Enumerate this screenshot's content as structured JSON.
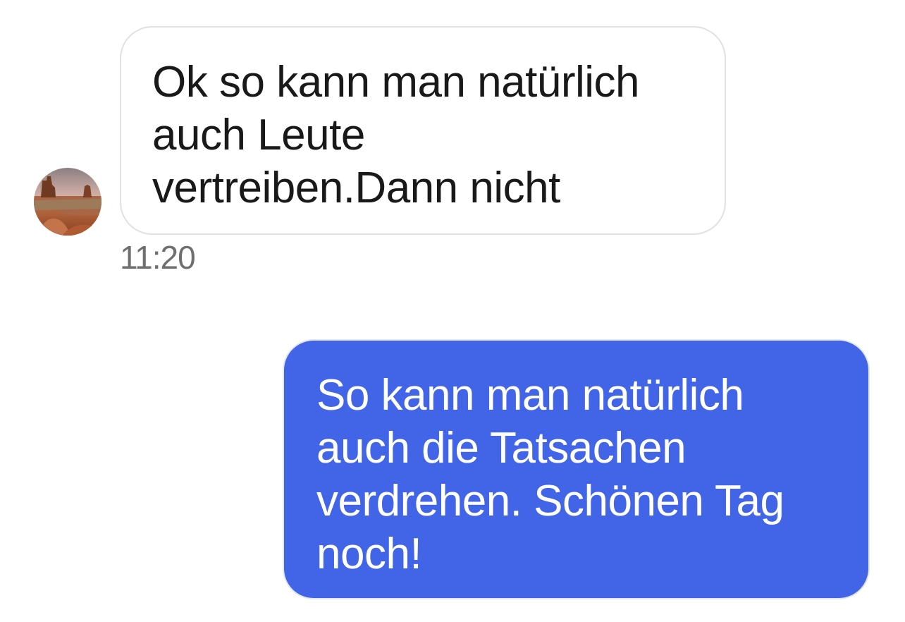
{
  "conversation": {
    "messages": [
      {
        "direction": "incoming",
        "text": "Ok so kann man natürlich\nauch Leute\nvertreiben.Dann nicht",
        "time": "11:20"
      },
      {
        "direction": "outgoing",
        "text": "So kann man natürlich\nauch die Tatsachen\nverdrehen. Schönen Tag\nnoch!"
      }
    ]
  },
  "avatar": {
    "icon": "desert-landscape-avatar"
  },
  "colors": {
    "incoming_bubble_bg": "#ffffff",
    "incoming_bubble_border": "#e1e1e1",
    "incoming_text": "#191919",
    "outgoing_bubble_bg": "#4165e6",
    "outgoing_text": "#ffffff",
    "timestamp": "#6f6f6f"
  }
}
